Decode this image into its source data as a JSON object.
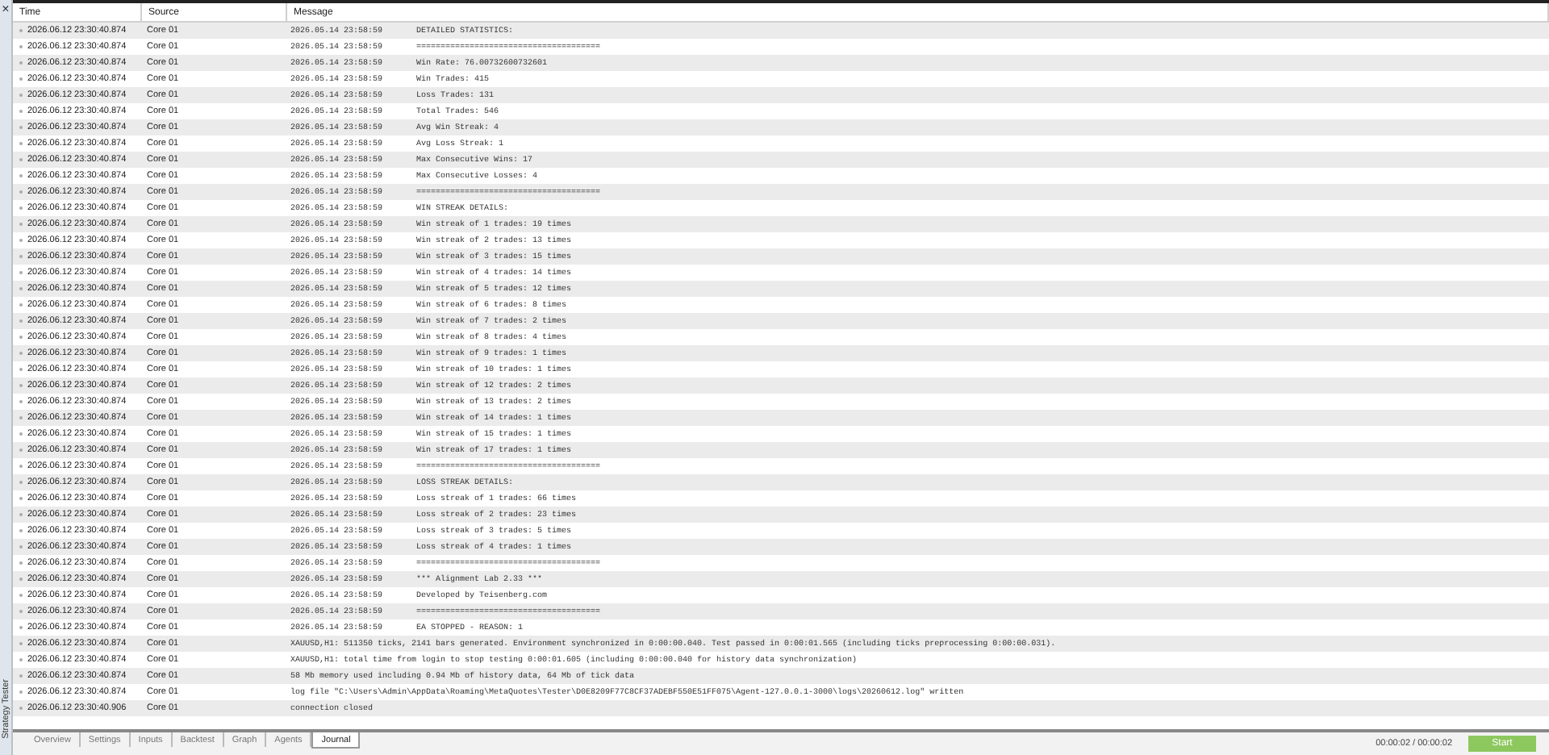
{
  "panel": {
    "close": "×",
    "title": "Strategy Tester"
  },
  "columns": [
    "Time",
    "Source",
    "Message"
  ],
  "rows": [
    {
      "time": "2026.06.12 23:30:40.874",
      "source": "Core 01",
      "stamp": "2026.05.14 23:58:59",
      "message": "DETAILED STATISTICS:"
    },
    {
      "time": "2026.06.12 23:30:40.874",
      "source": "Core 01",
      "stamp": "2026.05.14 23:58:59",
      "message": "======================================"
    },
    {
      "time": "2026.06.12 23:30:40.874",
      "source": "Core 01",
      "stamp": "2026.05.14 23:58:59",
      "message": "Win Rate: 76.00732600732601"
    },
    {
      "time": "2026.06.12 23:30:40.874",
      "source": "Core 01",
      "stamp": "2026.05.14 23:58:59",
      "message": "Win Trades: 415"
    },
    {
      "time": "2026.06.12 23:30:40.874",
      "source": "Core 01",
      "stamp": "2026.05.14 23:58:59",
      "message": "Loss Trades: 131"
    },
    {
      "time": "2026.06.12 23:30:40.874",
      "source": "Core 01",
      "stamp": "2026.05.14 23:58:59",
      "message": "Total Trades: 546"
    },
    {
      "time": "2026.06.12 23:30:40.874",
      "source": "Core 01",
      "stamp": "2026.05.14 23:58:59",
      "message": "Avg Win Streak: 4"
    },
    {
      "time": "2026.06.12 23:30:40.874",
      "source": "Core 01",
      "stamp": "2026.05.14 23:58:59",
      "message": "Avg Loss Streak: 1"
    },
    {
      "time": "2026.06.12 23:30:40.874",
      "source": "Core 01",
      "stamp": "2026.05.14 23:58:59",
      "message": "Max Consecutive Wins: 17"
    },
    {
      "time": "2026.06.12 23:30:40.874",
      "source": "Core 01",
      "stamp": "2026.05.14 23:58:59",
      "message": "Max Consecutive Losses: 4"
    },
    {
      "time": "2026.06.12 23:30:40.874",
      "source": "Core 01",
      "stamp": "2026.05.14 23:58:59",
      "message": "======================================"
    },
    {
      "time": "2026.06.12 23:30:40.874",
      "source": "Core 01",
      "stamp": "2026.05.14 23:58:59",
      "message": "WIN STREAK DETAILS:"
    },
    {
      "time": "2026.06.12 23:30:40.874",
      "source": "Core 01",
      "stamp": "2026.05.14 23:58:59",
      "message": "Win streak of 1 trades: 19 times"
    },
    {
      "time": "2026.06.12 23:30:40.874",
      "source": "Core 01",
      "stamp": "2026.05.14 23:58:59",
      "message": "Win streak of 2 trades: 13 times"
    },
    {
      "time": "2026.06.12 23:30:40.874",
      "source": "Core 01",
      "stamp": "2026.05.14 23:58:59",
      "message": "Win streak of 3 trades: 15 times"
    },
    {
      "time": "2026.06.12 23:30:40.874",
      "source": "Core 01",
      "stamp": "2026.05.14 23:58:59",
      "message": "Win streak of 4 trades: 14 times"
    },
    {
      "time": "2026.06.12 23:30:40.874",
      "source": "Core 01",
      "stamp": "2026.05.14 23:58:59",
      "message": "Win streak of 5 trades: 12 times"
    },
    {
      "time": "2026.06.12 23:30:40.874",
      "source": "Core 01",
      "stamp": "2026.05.14 23:58:59",
      "message": "Win streak of 6 trades: 8 times"
    },
    {
      "time": "2026.06.12 23:30:40.874",
      "source": "Core 01",
      "stamp": "2026.05.14 23:58:59",
      "message": "Win streak of 7 trades: 2 times"
    },
    {
      "time": "2026.06.12 23:30:40.874",
      "source": "Core 01",
      "stamp": "2026.05.14 23:58:59",
      "message": "Win streak of 8 trades: 4 times"
    },
    {
      "time": "2026.06.12 23:30:40.874",
      "source": "Core 01",
      "stamp": "2026.05.14 23:58:59",
      "message": "Win streak of 9 trades: 1 times"
    },
    {
      "time": "2026.06.12 23:30:40.874",
      "source": "Core 01",
      "stamp": "2026.05.14 23:58:59",
      "message": "Win streak of 10 trades: 1 times"
    },
    {
      "time": "2026.06.12 23:30:40.874",
      "source": "Core 01",
      "stamp": "2026.05.14 23:58:59",
      "message": "Win streak of 12 trades: 2 times"
    },
    {
      "time": "2026.06.12 23:30:40.874",
      "source": "Core 01",
      "stamp": "2026.05.14 23:58:59",
      "message": "Win streak of 13 trades: 2 times"
    },
    {
      "time": "2026.06.12 23:30:40.874",
      "source": "Core 01",
      "stamp": "2026.05.14 23:58:59",
      "message": "Win streak of 14 trades: 1 times"
    },
    {
      "time": "2026.06.12 23:30:40.874",
      "source": "Core 01",
      "stamp": "2026.05.14 23:58:59",
      "message": "Win streak of 15 trades: 1 times"
    },
    {
      "time": "2026.06.12 23:30:40.874",
      "source": "Core 01",
      "stamp": "2026.05.14 23:58:59",
      "message": "Win streak of 17 trades: 1 times"
    },
    {
      "time": "2026.06.12 23:30:40.874",
      "source": "Core 01",
      "stamp": "2026.05.14 23:58:59",
      "message": "======================================"
    },
    {
      "time": "2026.06.12 23:30:40.874",
      "source": "Core 01",
      "stamp": "2026.05.14 23:58:59",
      "message": "LOSS STREAK DETAILS:"
    },
    {
      "time": "2026.06.12 23:30:40.874",
      "source": "Core 01",
      "stamp": "2026.05.14 23:58:59",
      "message": "Loss streak of 1 trades: 66 times"
    },
    {
      "time": "2026.06.12 23:30:40.874",
      "source": "Core 01",
      "stamp": "2026.05.14 23:58:59",
      "message": "Loss streak of 2 trades: 23 times"
    },
    {
      "time": "2026.06.12 23:30:40.874",
      "source": "Core 01",
      "stamp": "2026.05.14 23:58:59",
      "message": "Loss streak of 3 trades: 5 times"
    },
    {
      "time": "2026.06.12 23:30:40.874",
      "source": "Core 01",
      "stamp": "2026.05.14 23:58:59",
      "message": "Loss streak of 4 trades: 1 times"
    },
    {
      "time": "2026.06.12 23:30:40.874",
      "source": "Core 01",
      "stamp": "2026.05.14 23:58:59",
      "message": "======================================"
    },
    {
      "time": "2026.06.12 23:30:40.874",
      "source": "Core 01",
      "stamp": "2026.05.14 23:58:59",
      "message": "*** Alignment Lab 2.33 ***"
    },
    {
      "time": "2026.06.12 23:30:40.874",
      "source": "Core 01",
      "stamp": "2026.05.14 23:58:59",
      "message": "Developed by Teisenberg.com"
    },
    {
      "time": "2026.06.12 23:30:40.874",
      "source": "Core 01",
      "stamp": "2026.05.14 23:58:59",
      "message": "======================================"
    },
    {
      "time": "2026.06.12 23:30:40.874",
      "source": "Core 01",
      "stamp": "2026.05.14 23:58:59",
      "message": "EA STOPPED - REASON: 1"
    },
    {
      "time": "2026.06.12 23:30:40.874",
      "source": "Core 01",
      "message": "XAUUSD,H1: 511350 ticks, 2141 bars generated. Environment synchronized in 0:00:00.040. Test passed in 0:00:01.565 (including ticks preprocessing 0:00:00.031)."
    },
    {
      "time": "2026.06.12 23:30:40.874",
      "source": "Core 01",
      "message": "XAUUSD,H1: total time from login to stop testing 0:00:01.605 (including 0:00:00.040 for history data synchronization)"
    },
    {
      "time": "2026.06.12 23:30:40.874",
      "source": "Core 01",
      "message": "58 Mb memory used including 0.94 Mb of history data, 64 Mb of tick data"
    },
    {
      "time": "2026.06.12 23:30:40.874",
      "source": "Core 01",
      "message": "log file \"C:\\Users\\Admin\\AppData\\Roaming\\MetaQuotes\\Tester\\D0E8209F77C8CF37ADEBF550E51FF075\\Agent-127.0.0.1-3000\\logs\\20260612.log\" written"
    },
    {
      "time": "2026.06.12 23:30:40.906",
      "source": "Core 01",
      "message": "connection closed"
    }
  ],
  "tabs": [
    {
      "label": "Overview",
      "selected": false
    },
    {
      "label": "Settings",
      "selected": false
    },
    {
      "label": "Inputs",
      "selected": false
    },
    {
      "label": "Backtest",
      "selected": false
    },
    {
      "label": "Graph",
      "selected": false
    },
    {
      "label": "Agents",
      "selected": false
    },
    {
      "label": "Journal",
      "selected": true
    }
  ],
  "elapsed": "00:00:02 / 00:00:02",
  "start_button": "Start"
}
